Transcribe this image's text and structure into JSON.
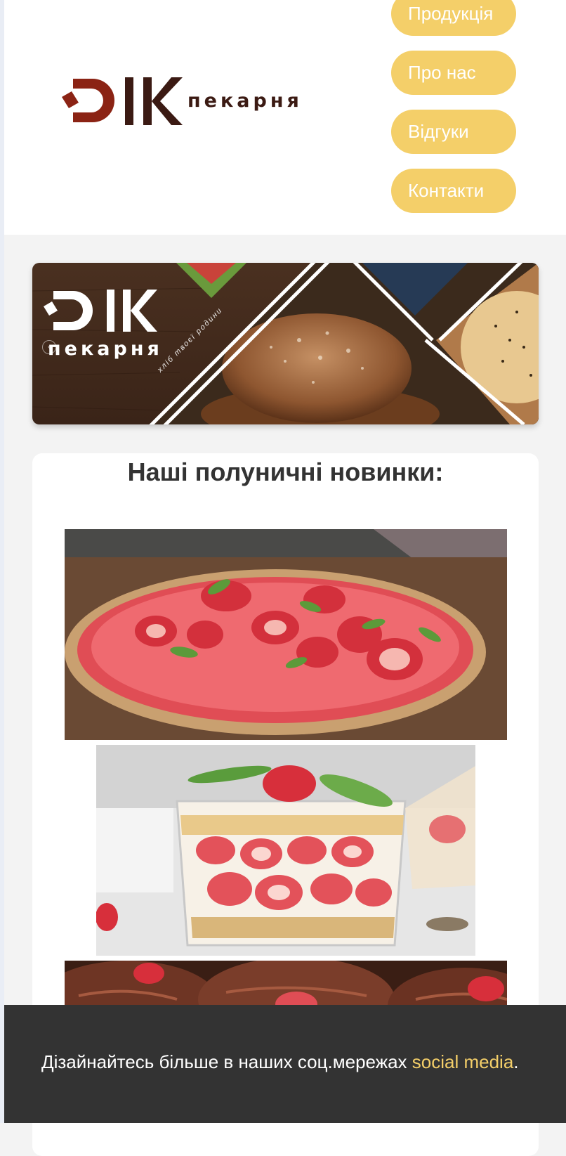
{
  "header": {
    "logo_word": "пекарня",
    "nav": [
      {
        "label": "Продукція"
      },
      {
        "label": "Про нас"
      },
      {
        "label": "Відгуки"
      },
      {
        "label": "Контакти"
      }
    ]
  },
  "hero": {
    "logo_word": "пекарня",
    "slogan": "хліб твоєї родини",
    "prev_arrow": "‹"
  },
  "products": {
    "title": "Наші полуничні новинки:",
    "photos": [
      "strawberry-tart-photo",
      "strawberry-trifle-photo",
      "chocolate-strawberry-photo"
    ]
  },
  "footer": {
    "text": "Дізайнайтесь більше в наших соц.мережах ",
    "link": "social media",
    "after": "."
  },
  "colors": {
    "accent": "#f4cf69",
    "footer_bg": "#333333",
    "logo_red": "#8b2314"
  }
}
